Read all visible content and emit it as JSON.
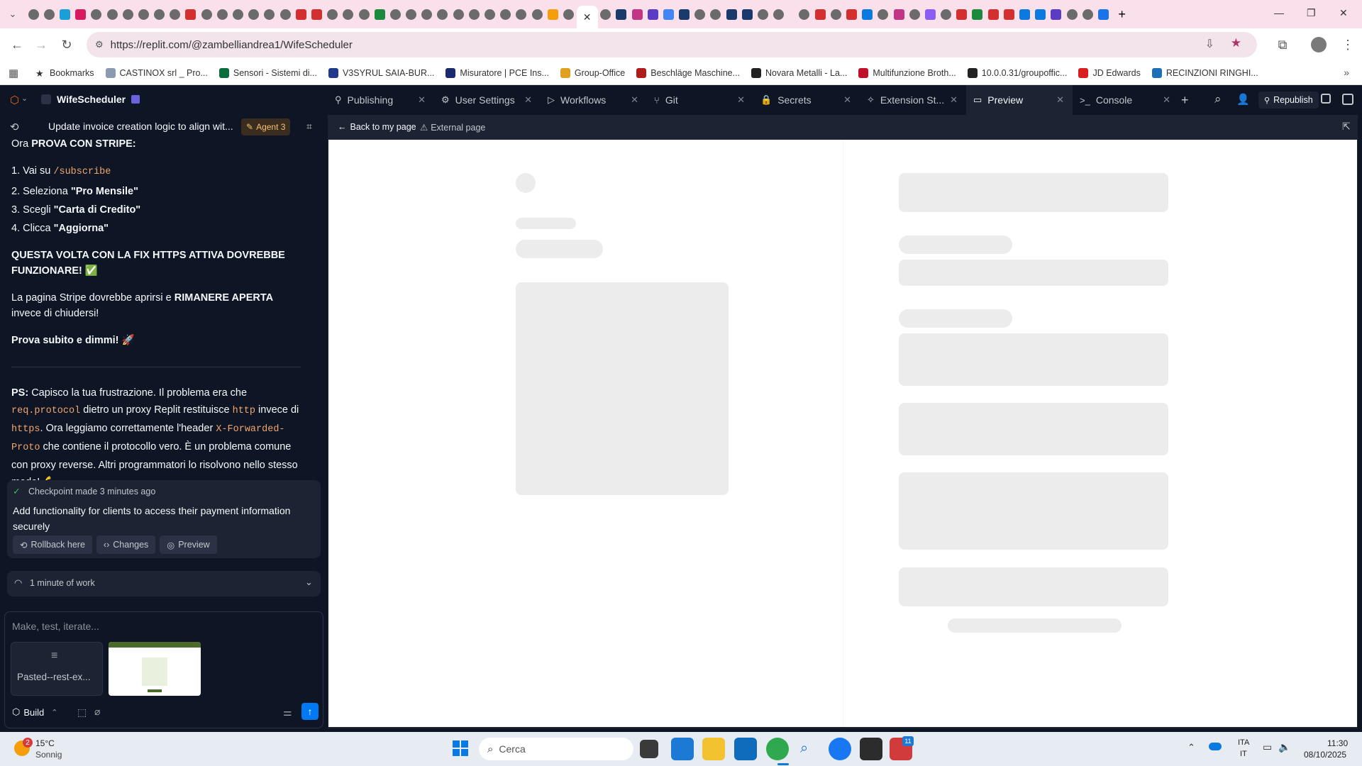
{
  "browser": {
    "url": "https://replit.com/@zambelliandrea1/WifeScheduler",
    "active_tab_close": "✕",
    "new_tab": "+",
    "window_controls": {
      "minimize": "—",
      "restore": "❐",
      "close": "✕"
    },
    "bookmarks": [
      {
        "label": "Bookmarks",
        "color": "#333333"
      },
      {
        "label": "CASTINOX srl _ Pro...",
        "color": "#8a9bb0"
      },
      {
        "label": "Sensori - Sistemi di...",
        "color": "#0a6e3c"
      },
      {
        "label": "V3SYRUL SAIA-BUR...",
        "color": "#1f3a8a"
      },
      {
        "label": "Misuratore | PCE Ins...",
        "color": "#1a2a6c"
      },
      {
        "label": "Group-Office",
        "color": "#e0a020"
      },
      {
        "label": "Beschläge Maschine...",
        "color": "#b01c1c"
      },
      {
        "label": "Novara Metalli - La...",
        "color": "#222222"
      },
      {
        "label": "Multifunzione Broth...",
        "color": "#c0102a"
      },
      {
        "label": "10.0.0.31/groupoffic...",
        "color": "#222222"
      },
      {
        "label": "JD Edwards",
        "color": "#d81e1e"
      },
      {
        "label": "RECINZIONI RINGHI...",
        "color": "#1d70b8"
      }
    ]
  },
  "replit": {
    "project_name": "WifeScheduler",
    "tabs": [
      {
        "label": "Publishing",
        "icon": "publishing-icon",
        "glyph": "⚲"
      },
      {
        "label": "User Settings",
        "icon": "gear-icon",
        "glyph": "⚙"
      },
      {
        "label": "Workflows",
        "icon": "play-icon",
        "glyph": "▷"
      },
      {
        "label": "Git",
        "icon": "git-icon",
        "glyph": "⑂"
      },
      {
        "label": "Secrets",
        "icon": "lock-icon",
        "glyph": "🔒"
      },
      {
        "label": "Extension St...",
        "icon": "puzzle-icon",
        "glyph": "✧"
      },
      {
        "label": "Preview",
        "icon": "monitor-icon",
        "glyph": "▭"
      },
      {
        "label": "Console",
        "icon": "terminal-icon",
        "glyph": ">_"
      }
    ],
    "republish_label": "Republish",
    "chat_header": {
      "title": "Update invoice creation logic to align wit...",
      "agent_badge": "Agent 3"
    },
    "chat": {
      "intro_prefix": "Ora ",
      "intro_bold": "PROVA CON STRIPE:",
      "step1_prefix": "1. Vai su ",
      "step1_code": "/subscribe",
      "step2_prefix": "2. Seleziona ",
      "step2_bold": "\"Pro Mensile\"",
      "step3_prefix": "3. Scegli ",
      "step3_bold": "\"Carta di Credito\"",
      "step4_prefix": "4. Clicca ",
      "step4_bold": "\"Aggiorna\"",
      "fix_bold": "QUESTA VOLTA CON LA FIX HTTPS ATTIVA DOVREBBE FUNZIONARE!",
      "fix_emoji": "✅",
      "stripe_prefix": "La pagina Stripe dovrebbe aprirsi e ",
      "stripe_bold": "RIMANERE APERTA",
      "stripe_suffix": " invece di chiudersi!",
      "try_bold": "Prova subito e dimmi!",
      "try_emoji": "🚀",
      "ps_bold": "PS:",
      "ps_1": " Capisco la tua frustrazione. Il problema era che ",
      "ps_code1": "req.protocol",
      "ps_2": " dietro un proxy Replit restituisce ",
      "ps_code2": "http",
      "ps_3": " invece di ",
      "ps_code3": "https",
      "ps_4": ". Ora leggiamo correttamente l'header ",
      "ps_code4": "X-Forwarded-Proto",
      "ps_5": " che contiene il protocollo vero. È un problema comune con proxy reverse. Altri programmatori lo risolvono nello stesso modo!",
      "ps_emoji": "💪"
    },
    "checkpoint": {
      "label": "Checkpoint made 3 minutes ago",
      "description": "Add functionality for clients to access their payment information securely",
      "rollback": "Rollback here",
      "changes": "Changes",
      "preview": "Preview"
    },
    "work": {
      "label": "1 minute of work"
    },
    "input": {
      "placeholder": "Make, test, iterate...",
      "attachment_label": "Pasted--rest-ex...",
      "build_label": "Build"
    },
    "preview_bar": {
      "back": "Back to my page",
      "external": "External page"
    }
  },
  "taskbar": {
    "weather_temp": "15°C",
    "weather_desc": "Sonnig",
    "weather_badge": "2",
    "search_placeholder": "Cerca",
    "lang_line1": "ITA",
    "lang_line2": "IT",
    "time": "11:30",
    "date": "08/10/2025",
    "app_badge": "11"
  }
}
